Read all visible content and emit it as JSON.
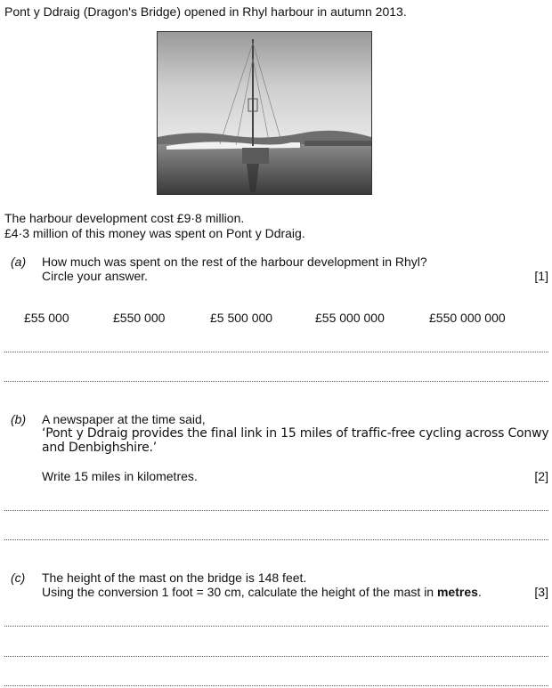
{
  "intro": "Pont y Ddraig (Dragon's Bridge) opened in Rhyl harbour in autumn 2013.",
  "photo_icon": "bridge-photo",
  "cost_line1": "The harbour development cost £9·8 million.",
  "cost_line2": "£4·3 million of this money was spent on Pont y Ddraig.",
  "part_a": {
    "label": "(a)",
    "question": "How much was spent on the rest of the harbour development in Rhyl?",
    "instruction": "Circle your answer.",
    "marks": "[1]",
    "options": [
      "£55 000",
      "£550 000",
      "£5 500 000",
      "£55 000 000",
      "£550 000 000"
    ]
  },
  "part_b": {
    "label": "(b)",
    "intro": "A newspaper at the time said,",
    "quote_line1": "‘Pont y Ddraig provides the final link in 15 miles of traffic-free cycling across Conwy",
    "quote_line2": "and Denbighshire.’",
    "instruction": "Write 15 miles in kilometres.",
    "marks": "[2]"
  },
  "part_c": {
    "label": "(c)",
    "line1": "The height of the mast on the bridge is 148 feet.",
    "line2_prefix": "Using the conversion 1 foot = 30 cm, calculate the height of the mast in ",
    "line2_bold": "metres",
    "line2_suffix": ".",
    "marks": "[3]"
  }
}
